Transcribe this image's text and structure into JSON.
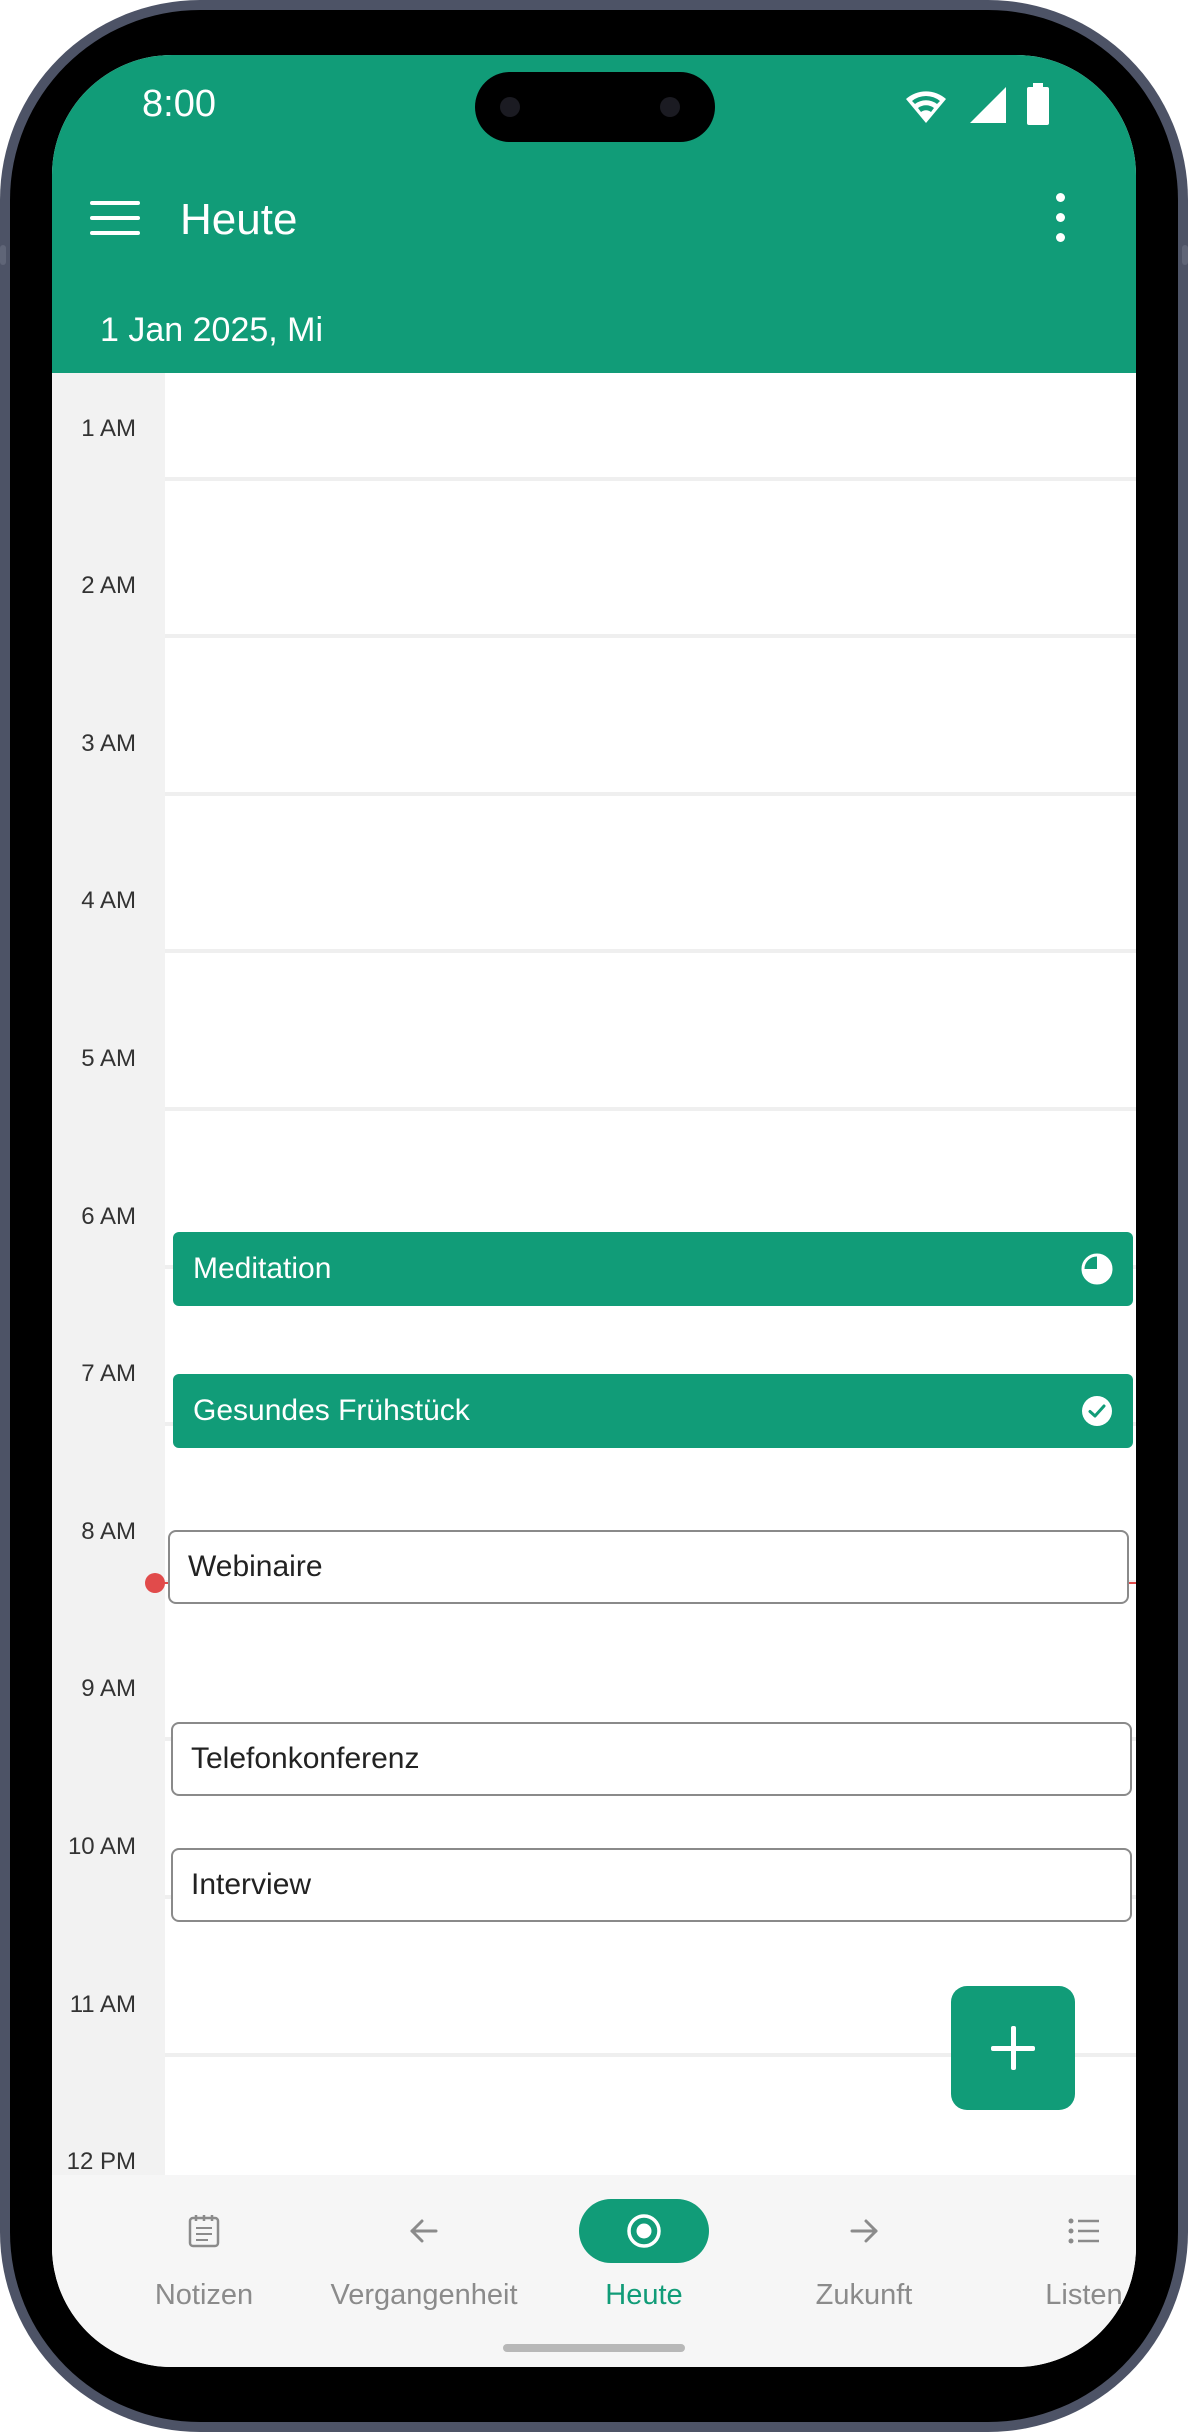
{
  "status_bar": {
    "time": "8:00"
  },
  "header": {
    "title": "Heute",
    "date": "1 Jan 2025, Mi"
  },
  "calendar": {
    "hours": [
      "1 AM",
      "2 AM",
      "3 AM",
      "4 AM",
      "5 AM",
      "6 AM",
      "7 AM",
      "8 AM",
      "9 AM",
      "10 AM",
      "11 AM",
      "12 PM"
    ],
    "events": [
      {
        "title": "Meditation",
        "style": "filled",
        "status_icon": "pie-progress-icon"
      },
      {
        "title": "Gesundes Frühstück",
        "style": "filled",
        "status_icon": "check-circle-icon"
      },
      {
        "title": "Webinaire",
        "style": "outline"
      },
      {
        "title": "Telefonkonferenz",
        "style": "outline"
      },
      {
        "title": "Interview",
        "style": "outline"
      }
    ]
  },
  "bottom_nav": {
    "items": [
      {
        "label": "Notizen",
        "icon": "notes-icon"
      },
      {
        "label": "Vergangenheit",
        "icon": "arrow-left-icon"
      },
      {
        "label": "Heute",
        "icon": "target-icon",
        "active": true
      },
      {
        "label": "Zukunft",
        "icon": "arrow-right-icon"
      },
      {
        "label": "Listen",
        "icon": "list-icon"
      }
    ]
  },
  "colors": {
    "primary": "#119c78",
    "now_line": "#e14b4b"
  }
}
